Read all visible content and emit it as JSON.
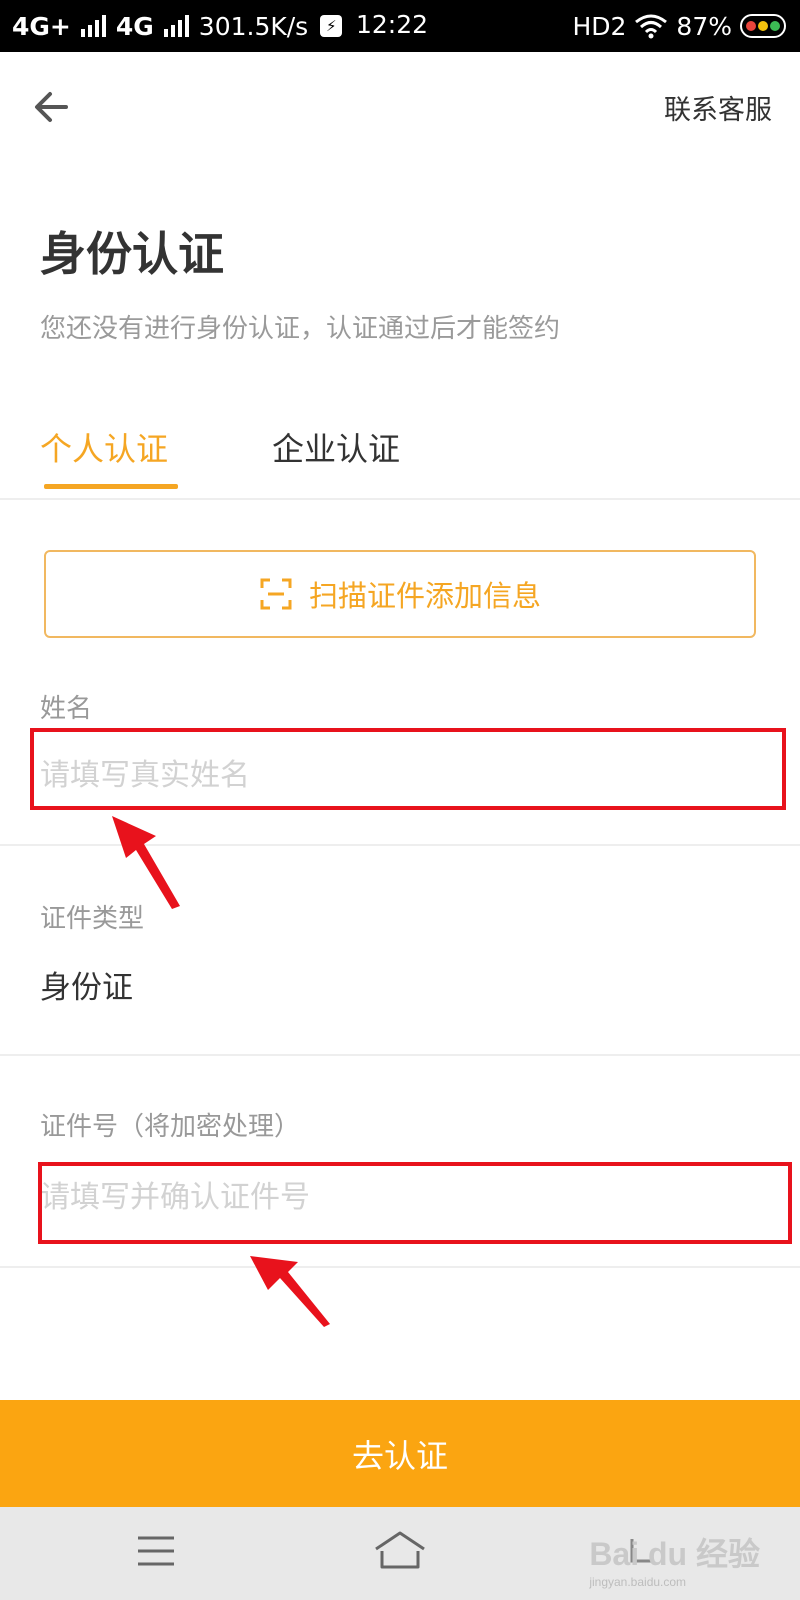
{
  "status_bar": {
    "network1": "4G+",
    "network2": "4G",
    "speed": "301.5K/s",
    "time": "12:22",
    "hd": "HD2",
    "battery": "87%"
  },
  "header": {
    "back_icon": "arrow-left-icon",
    "contact_label": "联系客服"
  },
  "page": {
    "title": "身份认证",
    "subtitle": "您还没有进行身份认证，认证通过后才能签约"
  },
  "tabs": [
    {
      "label": "个人认证",
      "active": true
    },
    {
      "label": "企业认证",
      "active": false
    }
  ],
  "scan": {
    "icon": "scan-frame-icon",
    "label": "扫描证件添加信息"
  },
  "form": {
    "name_label": "姓名",
    "name_placeholder": "请填写真实姓名",
    "id_type_label": "证件类型",
    "id_type_value": "身份证",
    "id_number_label": "证件号（将加密处理）",
    "id_number_placeholder": "请填写并确认证件号"
  },
  "submit_label": "去认证",
  "watermark": {
    "brand": "Bai du 经验",
    "url": "jingyan.baidu.com"
  },
  "colors": {
    "accent": "#f5a623",
    "submit_bg": "#fba511",
    "annotation": "#e8121c"
  }
}
